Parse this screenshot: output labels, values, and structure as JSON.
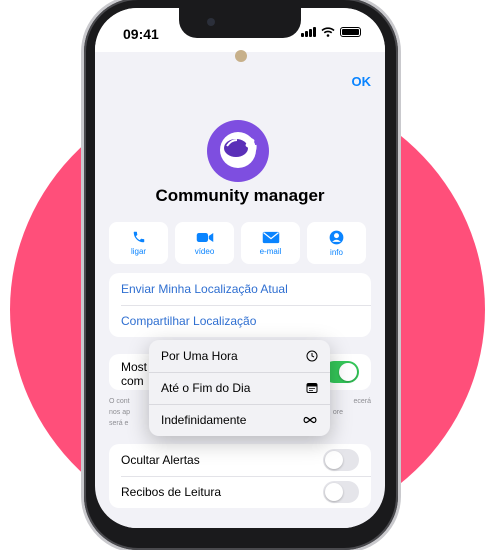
{
  "status_bar": {
    "time": "09:41"
  },
  "header": {
    "ok_label": "OK"
  },
  "contact": {
    "name": "Community manager"
  },
  "actions": [
    {
      "label": "ligar",
      "icon": "phone-icon"
    },
    {
      "label": "vídeo",
      "icon": "video-icon"
    },
    {
      "label": "e-mail",
      "icon": "mail-icon"
    },
    {
      "label": "info",
      "icon": "person-icon"
    }
  ],
  "location": {
    "send_current": "Enviar Minha Localização Atual",
    "share": "Compartilhar Localização"
  },
  "live_location": {
    "label_line1": "Most",
    "label_line2": "com",
    "enabled": true,
    "footnote_line1": "O cont",
    "footnote_line1_end": "ecerá",
    "footnote_line2": "nos ap",
    "footnote_line2_end": "ore",
    "footnote_line3": "será e"
  },
  "share_menu": {
    "options": [
      {
        "label": "Por Uma Hora",
        "icon": "clock-icon"
      },
      {
        "label": "Até o Fim do Dia",
        "icon": "calendar-icon"
      },
      {
        "label": "Indefinidamente",
        "icon": "infinity-icon"
      }
    ]
  },
  "settings": {
    "hide_alerts": {
      "label": "Ocultar Alertas",
      "enabled": false
    },
    "read_receipts": {
      "label": "Recibos de Leitura",
      "enabled": false
    }
  },
  "colors": {
    "accent": "#0a84ff",
    "link": "#2f6fd1",
    "toggle_on": "#34c759",
    "avatar_bg": "#7e4ee0",
    "background_circle": "#ff4f7a"
  }
}
